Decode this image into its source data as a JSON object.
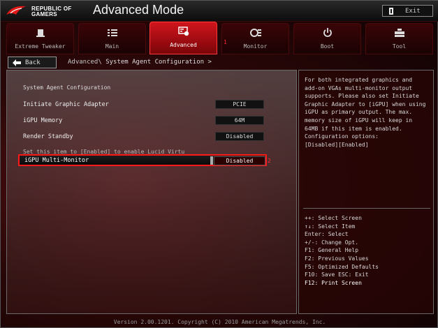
{
  "header": {
    "brand_line1": "REPUBLIC OF",
    "brand_line2": "GAMERS",
    "title": "Advanced Mode",
    "exit_label": "Exit"
  },
  "tabs": [
    {
      "label": "Extreme Tweaker",
      "icon": "tweaker-icon"
    },
    {
      "label": "Main",
      "icon": "list-icon"
    },
    {
      "label": "Advanced",
      "icon": "advanced-chip-icon",
      "active": true
    },
    {
      "label": "Monitor",
      "icon": "monitor-icon"
    },
    {
      "label": "Boot",
      "icon": "power-icon"
    },
    {
      "label": "Tool",
      "icon": "tool-icon"
    }
  ],
  "tab_marker": "1",
  "breadcrumb": {
    "back_label": "Back",
    "path": "Advanced\\ ",
    "current": "System Agent Configuration >"
  },
  "main": {
    "section_title": "System Agent Configuration",
    "items": [
      {
        "label": "Initiate Graphic Adapter",
        "value": "PCIE"
      },
      {
        "label": "iGPU Memory",
        "value": "64M"
      },
      {
        "label": "Render Standby",
        "value": "Disabled"
      }
    ],
    "note": "Set this item to [Enabled] to enable Lucid Virtu",
    "selected": {
      "label": "iGPU Multi-Monitor",
      "value": "Disabled"
    },
    "selected_marker": "2"
  },
  "help": {
    "text": [
      "For both integrated graphics and",
      "add-on VGAs multi-monitor output",
      "supports. Please also set Initiate",
      "Graphic Adapter to [iGPU] when using",
      "iGPU as primary output. The max.",
      "memory size of iGPU will keep in",
      "64MB if this item is enabled.",
      "Configuration options:",
      "[Disabled][Enabled]"
    ],
    "keys": [
      "++: Select Screen",
      "↑↓: Select Item",
      "Enter: Select",
      "+/-: Change Opt.",
      "F1: General Help",
      "F2: Previous Values",
      "F5: Optimized Defaults",
      "F10: Save  ESC: Exit"
    ],
    "key_highlight": "F12: Print Screen"
  },
  "footer": "Version 2.00.1201. Copyright (C) 2010 American Megatrends, Inc."
}
